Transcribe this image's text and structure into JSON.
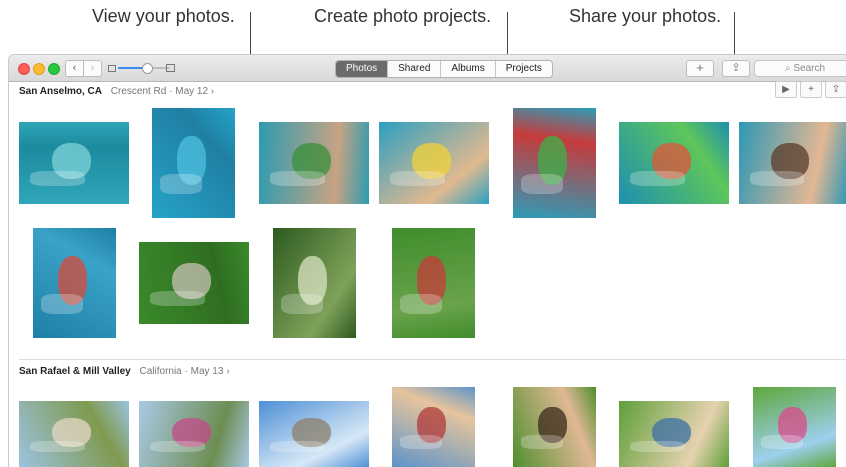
{
  "callouts": {
    "view": "View your photos.",
    "create": "Create photo projects.",
    "share": "Share your photos."
  },
  "toolbar": {
    "back_glyph": "‹",
    "forward_glyph": "›",
    "zoom_level": 0.55,
    "tabs": [
      "Photos",
      "Shared",
      "Albums",
      "Projects"
    ],
    "active_tab": "Photos",
    "add_glyph": "+",
    "share_glyph": "⇪",
    "search_placeholder": "⌕ Search"
  },
  "moments": [
    {
      "place": "San Anselmo, CA",
      "sub": "Crescent Rd",
      "date": "· May 12 ›",
      "actions": [
        "▶",
        "+",
        "⇪"
      ],
      "photos": [
        {
          "label": "boy swimming in pool",
          "palette": [
            "#2fa6b8",
            "#1d8a9e",
            "#7fd3d8"
          ]
        },
        {
          "label": "child with shark float",
          "palette": [
            "#26a3c9",
            "#1f7fa3",
            "#4ec0df"
          ]
        },
        {
          "label": "kids with water guns",
          "palette": [
            "#2d9bb0",
            "#c7a383",
            "#3a8f3a"
          ]
        },
        {
          "label": "boy with water gun",
          "palette": [
            "#2c9fc1",
            "#e0b98f",
            "#f0d23a"
          ]
        },
        {
          "label": "kids in pool with floats",
          "palette": [
            "#2e9cb8",
            "#c63b3b",
            "#3cb24a"
          ]
        },
        {
          "label": "child on green float",
          "palette": [
            "#1e8fb1",
            "#5ec65a",
            "#e0553a"
          ]
        },
        {
          "label": "boy smiling close-up",
          "palette": [
            "#2e98b5",
            "#e3b794",
            "#5b3b2a"
          ]
        }
      ]
    },
    {
      "row": 2,
      "photos": [
        {
          "label": "kids underwater",
          "palette": [
            "#1e7fa5",
            "#3aa3c7",
            "#d94a3a"
          ]
        },
        {
          "label": "father and son on grass",
          "palette": [
            "#3a8a2a",
            "#2f6e22",
            "#c8c2b5"
          ]
        },
        {
          "label": "tree canopy",
          "palette": [
            "#2c5a1f",
            "#7fa25a",
            "#d9e3c3"
          ]
        },
        {
          "label": "boy on bike in yard",
          "palette": [
            "#3f8d2c",
            "#6aa34a",
            "#c63b3b"
          ]
        }
      ]
    },
    {
      "place": "San Rafael & Mill Valley",
      "sub": "California",
      "date": "· May 13 ›",
      "photos": [
        {
          "label": "learning to ride bike",
          "palette": [
            "#9cc3e2",
            "#7f9a4f",
            "#e5d7c4"
          ]
        },
        {
          "label": "girl on bike by fence",
          "palette": [
            "#a9c9e6",
            "#6d8d52",
            "#c44a8a"
          ]
        },
        {
          "label": "bench by the bay",
          "palette": [
            "#4e8fd6",
            "#d7e8f6",
            "#8b7f6a"
          ]
        },
        {
          "label": "dad holding bike",
          "palette": [
            "#5c94c9",
            "#e6c49d",
            "#b03a3a"
          ]
        },
        {
          "label": "selfie on grass",
          "palette": [
            "#4f8f2e",
            "#e0b894",
            "#3c2a1d"
          ]
        },
        {
          "label": "kids playing in park",
          "palette": [
            "#5e9f38",
            "#e6d2b0",
            "#3a6fa6"
          ]
        },
        {
          "label": "girl with hula hoop",
          "palette": [
            "#5ea63c",
            "#9dd0ee",
            "#d94a8a"
          ]
        }
      ]
    }
  ]
}
